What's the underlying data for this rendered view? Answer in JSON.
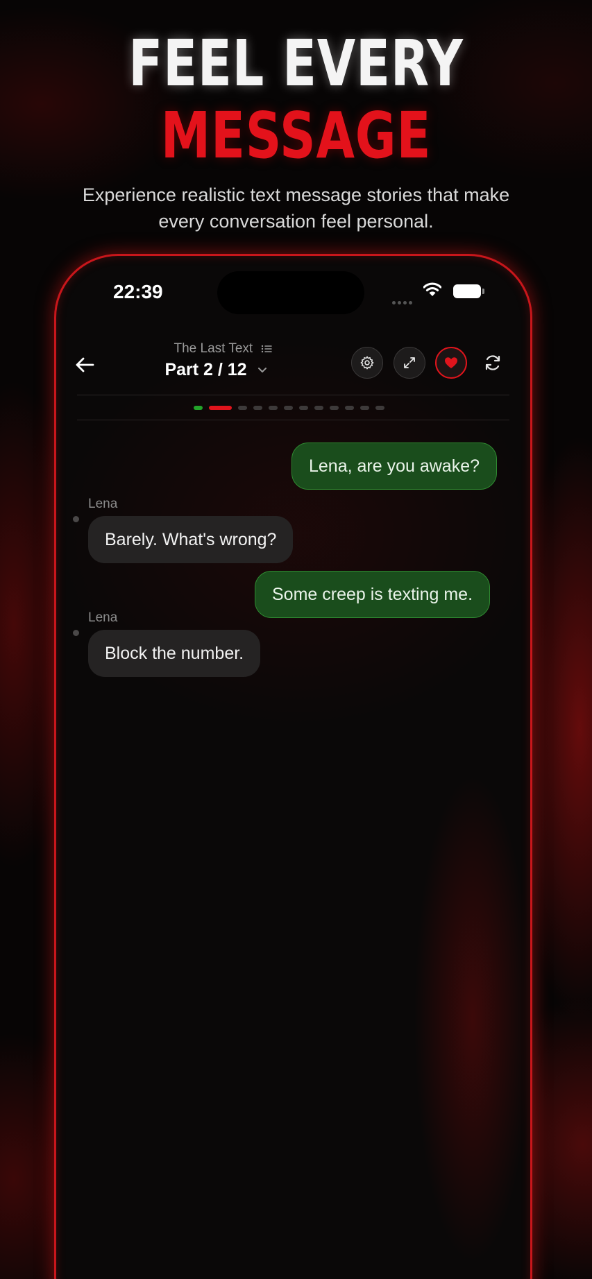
{
  "promo": {
    "headline_line1": "FEEL EVERY",
    "headline_line2": "MESSAGE",
    "subtitle": "Experience realistic text message stories that make every conversation feel personal."
  },
  "status_bar": {
    "time": "22:39"
  },
  "header": {
    "story_title": "The Last Text",
    "part_label": "Part 2 / 12",
    "part_current": 2,
    "part_total": 12
  },
  "colors": {
    "accent_red": "#e0141c",
    "sent_bubble": "#1a4d1c",
    "received_bubble": "#252323",
    "completed_progress": "#23a32a"
  },
  "icons": {
    "back": "arrow-left-icon",
    "settings": "gear-icon",
    "expand": "expand-icon",
    "favorite": "heart-icon",
    "refresh": "refresh-icon",
    "story_list": "list-icon",
    "part_dropdown": "chevron-down-icon"
  },
  "messages": [
    {
      "direction": "outgoing",
      "text": "Lena, are you awake?"
    },
    {
      "direction": "incoming",
      "sender": "Lena",
      "text": "Barely. What's wrong?"
    },
    {
      "direction": "outgoing",
      "text": "Some creep is texting me."
    },
    {
      "direction": "incoming",
      "sender": "Lena",
      "text": "Block the number."
    }
  ]
}
